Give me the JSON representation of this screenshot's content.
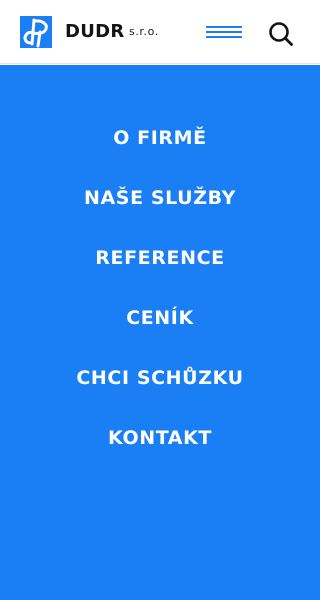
{
  "header": {
    "logo": {
      "name": "DUDR",
      "suffix": "s.r.o.",
      "mark_letters": "dP",
      "icon": "dp-logo-mark"
    },
    "menu_button": {
      "icon": "hamburger-menu-icon",
      "state": "open"
    },
    "search_button": {
      "icon": "search-icon"
    }
  },
  "nav": {
    "items": [
      {
        "label": "O FIRMĚ"
      },
      {
        "label": "NAŠE SLUŽBY"
      },
      {
        "label": "REFERENCE"
      },
      {
        "label": "CENÍK"
      },
      {
        "label": "CHCI SCHŮZKU"
      },
      {
        "label": "KONTAKT"
      }
    ]
  },
  "colors": {
    "accent": "#1a7ef5",
    "header_background": "#ffffff",
    "logo_text": "#141414",
    "nav_text": "#ffffff"
  }
}
